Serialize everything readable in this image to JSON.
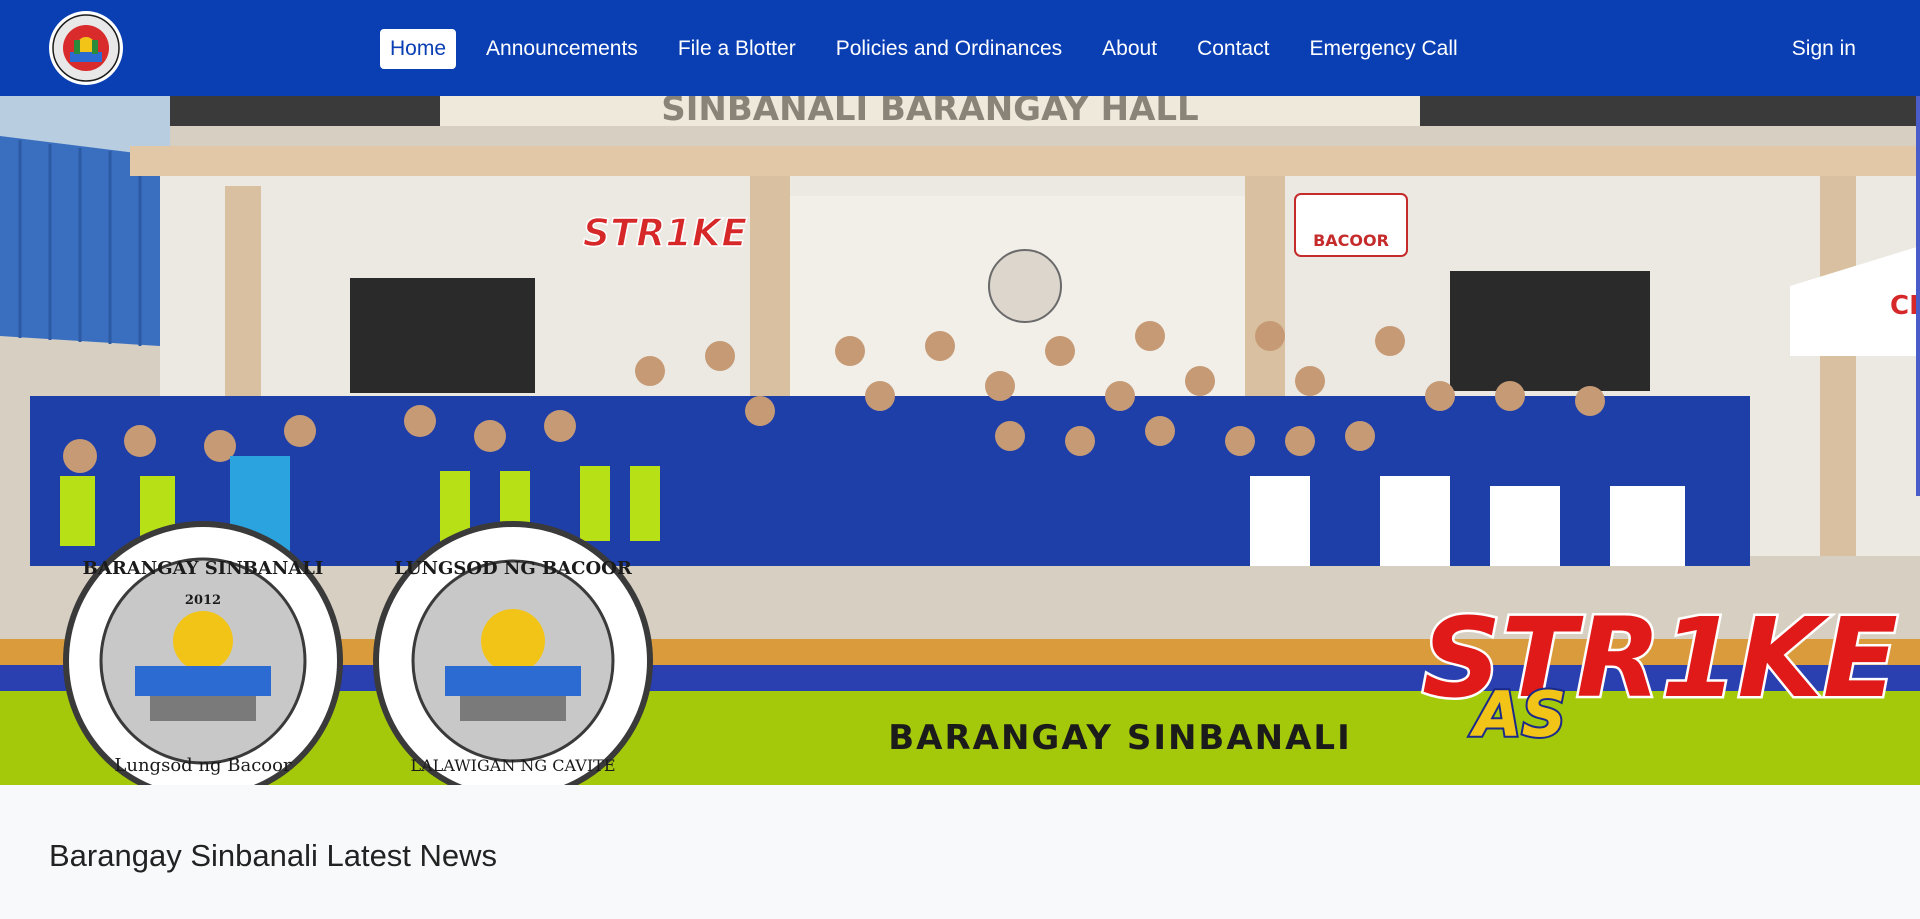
{
  "nav": {
    "logo_alt": "Barangay Sinbanali seal",
    "links": [
      {
        "label": "Home",
        "active": true
      },
      {
        "label": "Announcements",
        "active": false
      },
      {
        "label": "File a Blotter",
        "active": false
      },
      {
        "label": "Policies and Ordinances",
        "active": false
      },
      {
        "label": "About",
        "active": false
      },
      {
        "label": "Contact",
        "active": false
      },
      {
        "label": "Emergency Call",
        "active": false
      }
    ],
    "signin_label": "Sign in"
  },
  "hero": {
    "hall_sign": "SINBANALI BARANGAY HALL",
    "banner_text": "BARANGAY SINBANALI",
    "seal_left_top": "BARANGAY SINBANALI",
    "seal_left_year": "2012",
    "seal_left_bottom": "Lungsod ng Bacoor",
    "seal_right_top": "LUNGSOD NG BACOOR",
    "seal_right_bottom": "LALAWIGAN NG CAVITE",
    "strike_word": "STR1KE",
    "strike_sub": "AS",
    "wall_sign": "BACOOR"
  },
  "main": {
    "news_heading": "Barangay Sinbanali Latest News"
  },
  "colors": {
    "nav_bg": "#0a3fb4",
    "banner_green": "#a4c80a",
    "banner_orange": "#d99b3c",
    "banner_blue": "#2a3fb0"
  }
}
